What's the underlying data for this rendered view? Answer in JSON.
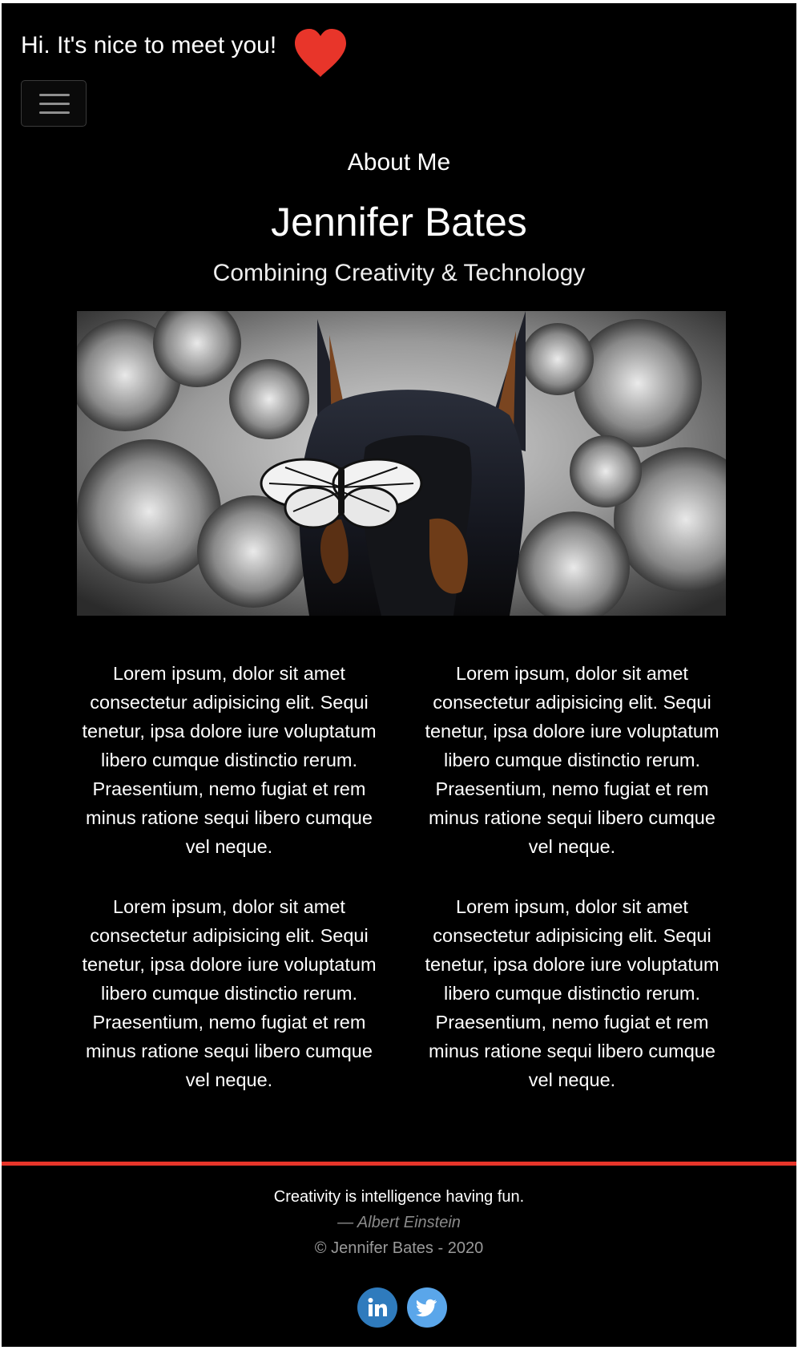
{
  "header": {
    "greeting": "Hi. It's nice to meet you!",
    "heart_icon": "heart-icon",
    "heart_color": "#e8352a",
    "menu_icon": "hamburger-menu-icon"
  },
  "hero": {
    "section_label": "About Me",
    "name": "Jennifer Bates",
    "tagline": "Combining Creativity & Technology",
    "image_alt": "Doberman with butterfly on its nose among flowers"
  },
  "paragraphs": [
    "Lorem ipsum, dolor sit amet consectetur adipisicing elit. Sequi tenetur, ipsa dolore iure voluptatum libero cumque distinctio rerum. Praesentium, nemo fugiat et rem minus ratione sequi libero cumque vel neque.",
    "Lorem ipsum, dolor sit amet consectetur adipisicing elit. Sequi tenetur, ipsa dolore iure voluptatum libero cumque distinctio rerum. Praesentium, nemo fugiat et rem minus ratione sequi libero cumque vel neque.",
    "Lorem ipsum, dolor sit amet consectetur adipisicing elit. Sequi tenetur, ipsa dolore iure voluptatum libero cumque distinctio rerum. Praesentium, nemo fugiat et rem minus ratione sequi libero cumque vel neque.",
    "Lorem ipsum, dolor sit amet consectetur adipisicing elit. Sequi tenetur, ipsa dolore iure voluptatum libero cumque distinctio rerum. Praesentium, nemo fugiat et rem minus ratione sequi libero cumque vel neque."
  ],
  "footer": {
    "quote": "Creativity is intelligence having fun.",
    "author": "— Albert Einstein",
    "copyright": "© Jennifer Bates - 2020",
    "accent_color": "#e8352a",
    "social": [
      {
        "name": "linkedin-icon",
        "color": "#2f7bbd"
      },
      {
        "name": "twitter-icon",
        "color": "#5aa6ea"
      }
    ]
  }
}
